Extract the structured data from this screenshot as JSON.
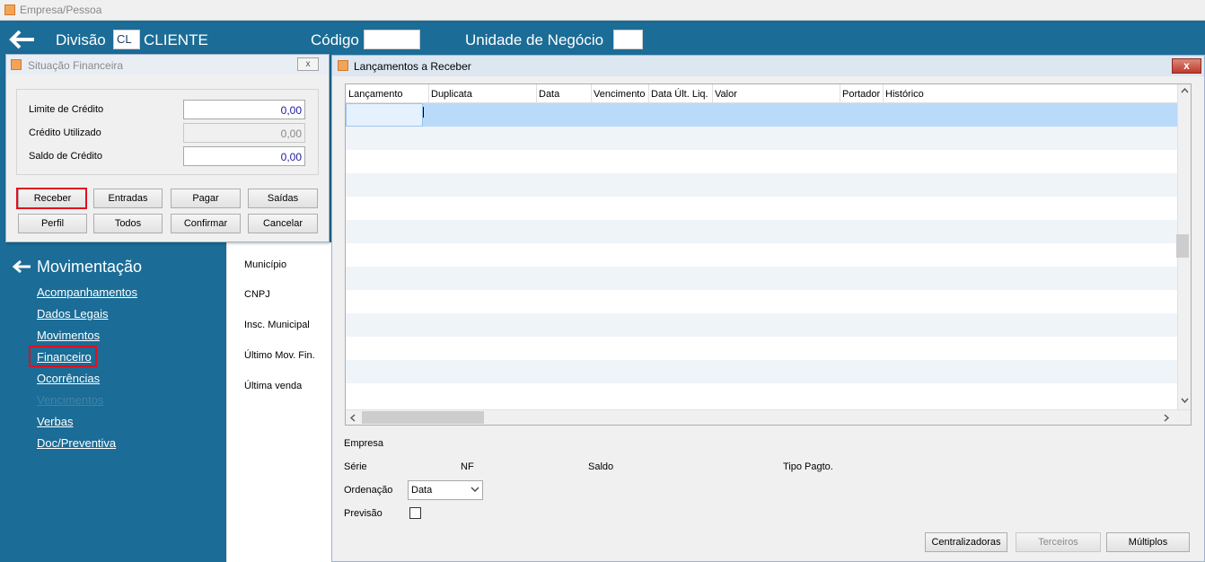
{
  "window": {
    "title": "Empresa/Pessoa"
  },
  "header": {
    "divisao_label": "Divisão",
    "divisao_code": "CL",
    "divisao_name": "CLIENTE",
    "codigo_label": "Código",
    "codigo_value": "",
    "unidade_label": "Unidade de Negócio",
    "unidade_value": ""
  },
  "sidebar": {
    "section_title": "Movimentação",
    "items": [
      {
        "label": "Acompanhamentos",
        "enabled": true
      },
      {
        "label": "Dados Legais",
        "enabled": true
      },
      {
        "label": "Movimentos",
        "enabled": true
      },
      {
        "label": "Financeiro",
        "enabled": true,
        "highlighted": true
      },
      {
        "label": "Ocorrências",
        "enabled": true
      },
      {
        "label": "Vencimentos",
        "enabled": false
      },
      {
        "label": "Verbas",
        "enabled": true
      },
      {
        "label": "Doc/Preventiva",
        "enabled": true
      }
    ]
  },
  "mid_panel": {
    "labels": [
      "Município",
      "CNPJ",
      "Insc. Municipal",
      "Último Mov. Fin.",
      "Última venda"
    ]
  },
  "situacao": {
    "title": "Situação Financeira",
    "close_label": "x",
    "limite_label": "Limite de Crédito",
    "limite_value": "0,00",
    "utilizado_label": "Crédito Utilizado",
    "utilizado_value": "0,00",
    "saldo_label": "Saldo de Crédito",
    "saldo_value": "0,00",
    "buttons_row1": [
      "Receber",
      "Entradas",
      "Pagar",
      "Saídas"
    ],
    "buttons_row2": [
      "Perfil",
      "Todos",
      "Confirmar",
      "Cancelar"
    ]
  },
  "lancamentos": {
    "title": "Lançamentos a Receber",
    "close_label": "x",
    "columns": [
      "Lançamento",
      "Duplicata",
      "Data",
      "Vencimento",
      "Data Últ. Liq.",
      "Valor",
      "Portador",
      "Histórico"
    ],
    "empresa_label": "Empresa",
    "serie_label": "Série",
    "nf_label": "NF",
    "saldo_label": "Saldo",
    "tipo_pagto_label": "Tipo Pagto.",
    "ordenacao_label": "Ordenação",
    "ordenacao_value": "Data",
    "previsao_label": "Previsão",
    "buttons": [
      "Centralizadoras",
      "Terceiros",
      "Múltiplos"
    ]
  },
  "colors": {
    "header_bg": "#1b6c96",
    "highlight_red": "#e01020",
    "selected_row": "#b9daf9",
    "alt_row": "#eff4f9"
  }
}
